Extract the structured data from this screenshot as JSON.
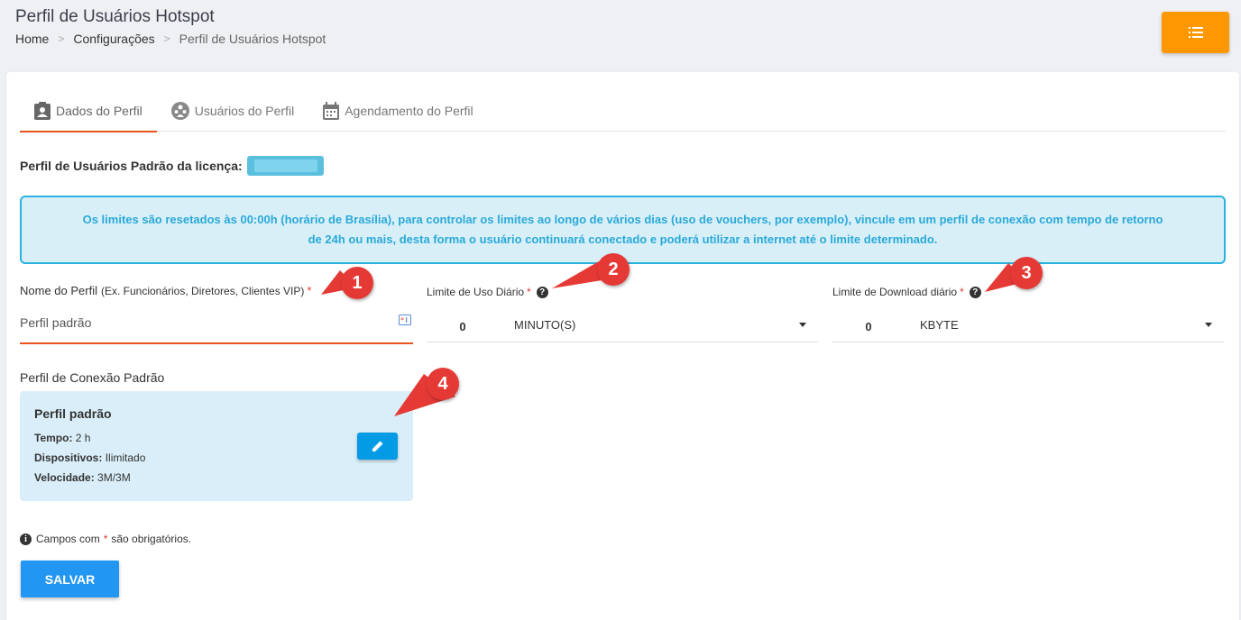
{
  "header": {
    "title": "Perfil de Usuários Hotspot",
    "breadcrumb": [
      "Home",
      "Configurações",
      "Perfil de Usuários Hotspot"
    ],
    "menu_icon": "list-icon",
    "menu_color": "#ff9800"
  },
  "tabs": [
    {
      "label": "Dados do Perfil",
      "icon": "profile-card-icon",
      "active": true
    },
    {
      "label": "Usuários do Perfil",
      "icon": "users-group-icon",
      "active": false
    },
    {
      "label": "Agendamento do Perfil",
      "icon": "calendar-icon",
      "active": false
    }
  ],
  "license": {
    "label": "Perfil de Usuários Padrão da licença:"
  },
  "info": {
    "line1": "Os limites são resetados às 00:00h (horário de Brasília), para controlar os limites ao longo de vários dias (uso de vouchers, por exemplo), vincule em um perfil de conexão com tempo de retorno",
    "line2": "de 24h ou mais, desta forma o usuário continuará conectado e poderá utilizar a internet até o limite determinado."
  },
  "fields": {
    "name": {
      "label": "Nome do Perfil",
      "hint": "(Ex. Funcionários, Diretores, Clientes VIP)",
      "required": "*",
      "value": "Perfil padrão"
    },
    "daily_usage": {
      "label": "Limite de Uso Diário",
      "required": "*",
      "help": "?",
      "value": "0",
      "unit": "MINUTO(S)"
    },
    "daily_download": {
      "label": "Limite de Download diário",
      "required": "*",
      "help": "?",
      "value": "0",
      "unit": "KBYTE"
    }
  },
  "connection": {
    "label": "Perfil de Conexão Padrão",
    "title": "Perfil padrão",
    "time_label": "Tempo:",
    "time_value": "2 h",
    "devices_label": "Dispositivos:",
    "devices_value": "Ilimitado",
    "speed_label": "Velocidade:",
    "speed_value": "3M/3M",
    "edit_icon": "pencil-icon"
  },
  "note": {
    "pre": "Campos com",
    "star": "*",
    "post": "são obrigatórios.",
    "icon": "info-icon"
  },
  "save_label": "SALVAR",
  "callouts": [
    "1",
    "2",
    "3",
    "4"
  ],
  "colors": {
    "accent": "#e8531f",
    "info_border": "#29b2e0",
    "save": "#2196f3",
    "callout": "#e53935"
  }
}
